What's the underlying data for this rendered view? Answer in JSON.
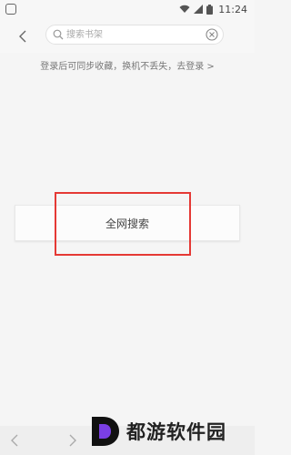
{
  "status_bar": {
    "time": "11:24",
    "icons": [
      "app-icon",
      "wifi-icon",
      "signal-icon",
      "battery-icon"
    ]
  },
  "search": {
    "placeholder": "搜索书架",
    "back_icon": "chevron-left-icon",
    "search_icon": "search-icon",
    "clear_icon": "clear-icon"
  },
  "sync_prompt": "登录后可同步收藏，换机不丢失，去登录 >",
  "global_search_label": "全网搜索",
  "watermark": {
    "text": "都游软件园",
    "logo": "d-logo-icon"
  },
  "colors": {
    "highlight": "#e53935",
    "watermark_accent": "#7b3fe4"
  }
}
